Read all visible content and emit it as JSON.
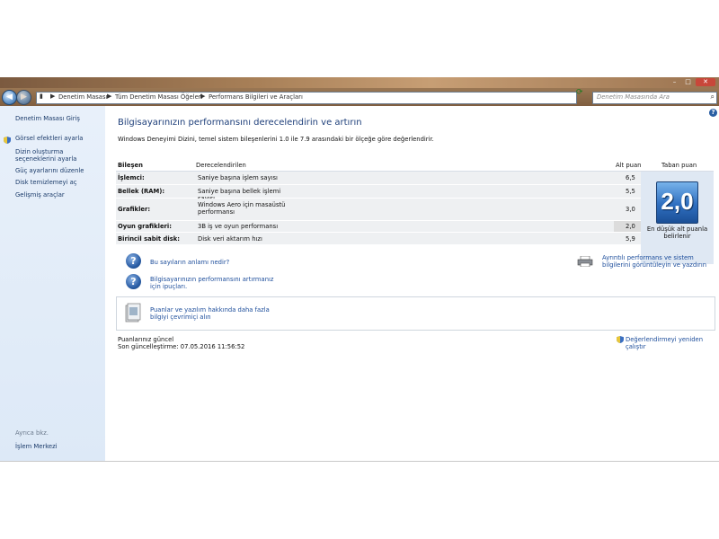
{
  "address": {
    "crumbs": [
      "Denetim Masası",
      "Tüm Denetim Masası Öğeleri",
      "Performans Bilgileri ve Araçları"
    ],
    "search_placeholder": "Denetim Masasında Ara"
  },
  "sidebar": {
    "items": [
      "Denetim Masası Giriş",
      "Görsel efektleri ayarla",
      "Dizin oluşturma seçeneklerini ayarla",
      "Güç ayarlarını düzenle",
      "Disk temizlemeyi aç",
      "Gelişmiş araçlar"
    ],
    "see_also_label": "Ayrıca bkz.",
    "see_also_items": [
      "İşlem Merkezi"
    ]
  },
  "main": {
    "title": "Bilgisayarınızın performansını derecelendirin ve artırın",
    "intro": "Windows Deneyimi Dizini, temel sistem bileşenlerini 1.0 ile 7.9 arasındaki bir ölçeğe göre değerlendirir.",
    "table": {
      "headers": {
        "component": "Bileşen",
        "rated": "Derecelendirilen",
        "subscore": "Alt puan",
        "base": "Taban puan"
      },
      "rows": [
        {
          "label": "İşlemci:",
          "desc": "Saniye başına işlem sayısı",
          "score": "6,5"
        },
        {
          "label": "Bellek (RAM):",
          "desc": "Saniye başına bellek işlemi sayısı",
          "score": "5,5"
        },
        {
          "label": "Grafikler:",
          "desc": "Windows Aero için masaüstü performansı",
          "score": "3,0"
        },
        {
          "label": "Oyun grafikleri:",
          "desc": "3B iş ve oyun performansı",
          "score": "2,0"
        },
        {
          "label": "Birincil sabit disk:",
          "desc": "Disk veri aktarım hızı",
          "score": "5,9"
        }
      ],
      "base_score": "2,0",
      "base_caption": "En düşük alt puanla belirlenir"
    },
    "links": {
      "meaning": "Bu sayıların anlamı nedir?",
      "tips": "Bilgisayarınızın performansını artırmanız için ipuçları.",
      "details": "Ayrıntılı performans ve sistem bilgilerini görüntüleyin ve yazdırın",
      "online": "Puanlar ve yazılım hakkında daha fazla bilgiyi çevrimiçi alın",
      "rerun": "Değerlendirmeyi yeniden çalıştır"
    },
    "status": {
      "current": "Puanlarınız güncel",
      "last_update": "Son güncelleştirme: 07.05.2016 11:56:52"
    }
  }
}
